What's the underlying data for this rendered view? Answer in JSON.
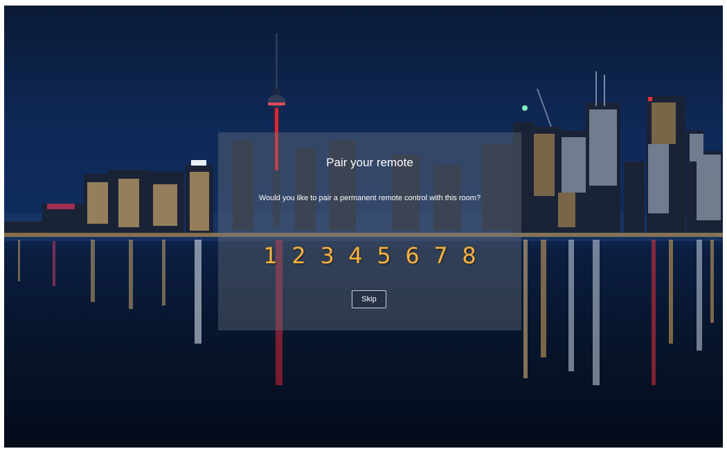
{
  "dialog": {
    "title": "Pair your remote",
    "subtitle": "Would you like to pair a permanent remote control with this room?",
    "code_digits": [
      "1",
      "2",
      "3",
      "4",
      "5",
      "6",
      "7",
      "8"
    ],
    "skip_label": "Skip"
  },
  "colors": {
    "digit": "#f0b24a",
    "sky_top": "#0a1a36",
    "water": "#040b1a"
  }
}
